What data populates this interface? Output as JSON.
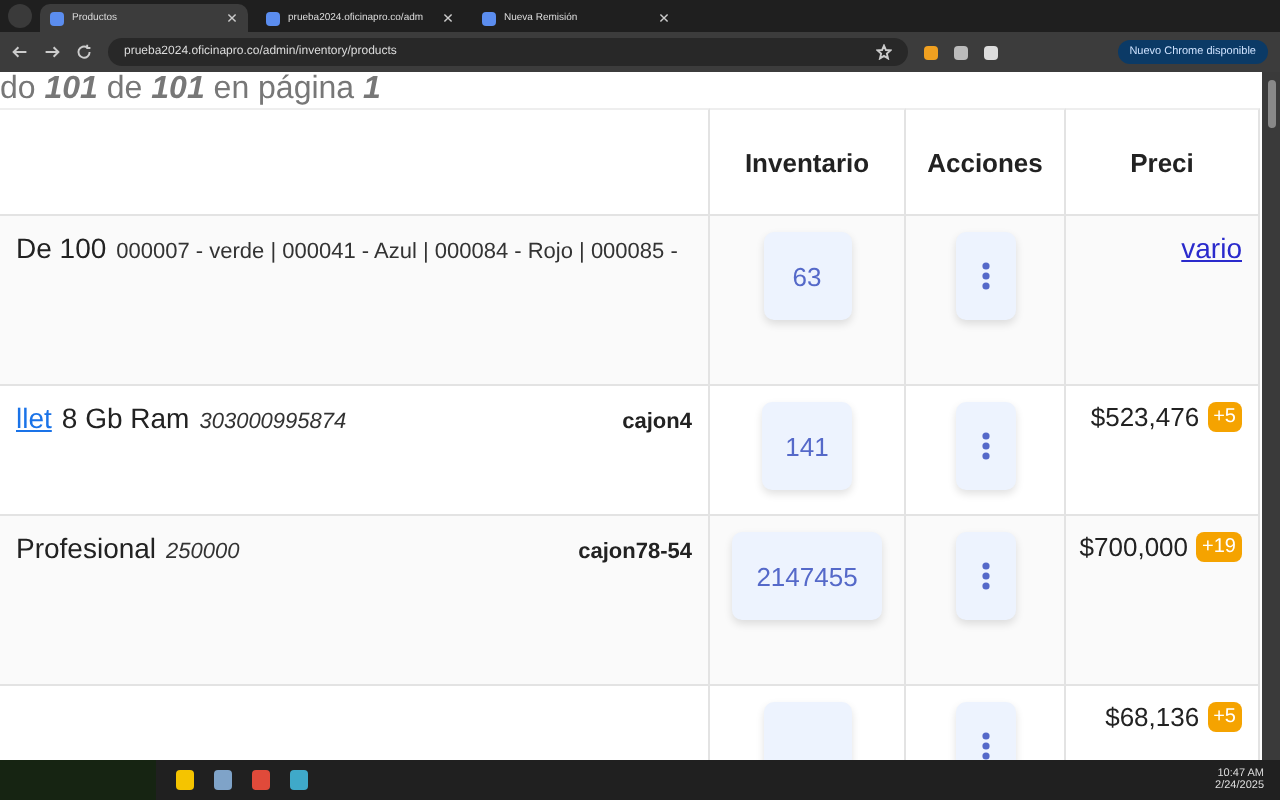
{
  "browser": {
    "tabs": [
      {
        "title": "Productos",
        "selected": true
      },
      {
        "title": "prueba2024.oficinapro.co/adm",
        "selected": false
      },
      {
        "title": "Nueva Remisión",
        "selected": false
      }
    ],
    "address": "prueba2024.oficinapro.co/admin/inventory/products",
    "update_button": "Nuevo Chrome disponible"
  },
  "summary": "do **101** de **101** en página **1**",
  "table": {
    "columns": [
      "Inventario",
      "Acciones",
      "Preci"
    ],
    "rows": [
      {
        "name_link": "",
        "name": "De 100",
        "detail": "000007 - verde | 000041 - Azul | 000084 - Rojo | 000085 -",
        "detail_italic": false,
        "location": "",
        "inventory": "63",
        "price_link": true,
        "price": "vario",
        "badge": ""
      },
      {
        "name_link": "llet",
        "name": "8 Gb Ram",
        "detail": "303000995874",
        "detail_italic": true,
        "location": "cajon4",
        "inventory": "141",
        "price_link": false,
        "price": "$523,476",
        "badge": "+5"
      },
      {
        "name_link": "",
        "name": "Profesional",
        "detail": "250000",
        "detail_italic": true,
        "location": "cajon78-54",
        "inventory": "2147455",
        "price_link": false,
        "price": "$700,000",
        "badge": "+19"
      },
      {
        "name_link": "",
        "name": "",
        "detail": "",
        "location": "",
        "inventory": "",
        "price_link": false,
        "price": "$68,136",
        "badge": "+5"
      }
    ]
  },
  "taskbar": {
    "time": "10:47 AM",
    "date": "2/24/2025"
  }
}
